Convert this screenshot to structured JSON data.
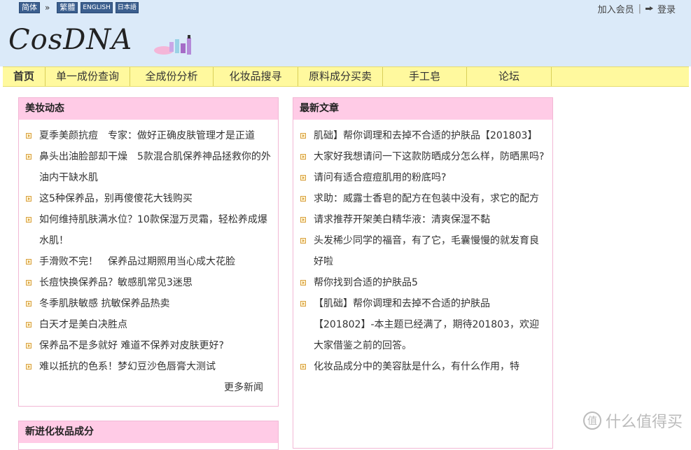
{
  "header": {
    "lang_buttons": [
      "简体",
      "繁體",
      "ENGLISH",
      "日本語"
    ],
    "lang_sep": "»",
    "join": "加入会员",
    "divider": "|",
    "login": "登录",
    "logo": "CosDNA"
  },
  "nav": {
    "items": [
      "首页",
      "单一成份查询",
      "全成份分析",
      "化妆品搜寻",
      "原料成分买卖",
      "手工皂",
      "论坛"
    ]
  },
  "news": {
    "title": "美妆动态",
    "items": [
      "夏季美颜抗痘　专家：做好正确皮肤管理才是正道",
      "鼻头出油脸部却干燥　5款混合肌保养神品拯救你的外油内干缺水肌",
      "这5种保养品，别再傻傻花大钱购买",
      "如何维持肌肤满水位？10款保湿万灵霜，轻松养成爆水肌！",
      "手滑败不完！　保养品过期照用当心成大花脸",
      "长痘快换保养品？敏感肌常见3迷思",
      "冬季肌肤敏感 抗敏保养品热卖",
      "白天才是美白决胜点",
      "保养品不是多就好 难道不保养对皮肤更好?",
      "难以抵抗的色系！梦幻豆沙色唇膏大测试"
    ],
    "more": "更多新闻"
  },
  "evolution": {
    "title": "新进化妆品成分"
  },
  "articles": {
    "title": "最新文章",
    "items": [
      "肌础】帮你调理和去掉不合适的护肤品【201803】",
      "大家好我想请问一下这款防晒成分怎么样，防晒黑吗?",
      "请问有适合痘痘肌用的粉底吗?",
      "求助：威露士香皂的配方在包装中没有，求它的配方",
      "请求推荐开架美白精华液：清爽保湿不黏",
      "头发稀少同学的福音，有了它，毛囊慢慢的就发育良好啦",
      "帮你找到合适的护肤品5",
      "【肌础】帮你调理和去掉不合适的护肤品【201802】-本主题已经满了，期待201803，欢迎大家借鉴之前的回答。",
      "化妆品成分中的美容肽是什么，有什么作用，特"
    ]
  },
  "watermark": {
    "icon_text": "值",
    "text": "什么值得买"
  }
}
